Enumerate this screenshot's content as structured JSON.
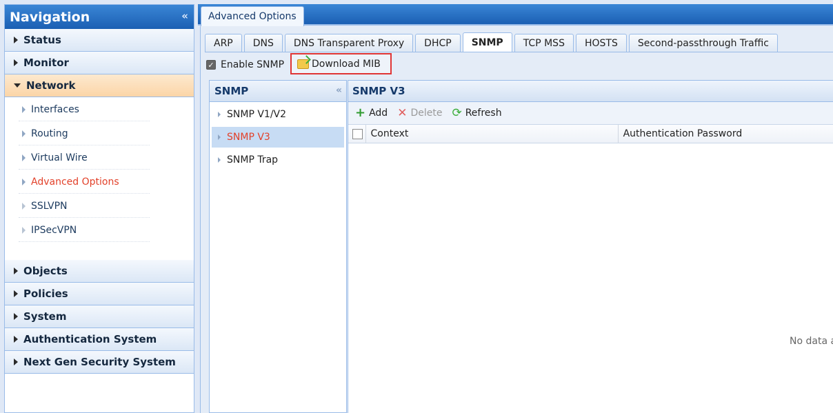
{
  "nav": {
    "title": "Navigation",
    "collapse_icon": "«",
    "sections_top": [
      {
        "label": "Status"
      },
      {
        "label": "Monitor"
      },
      {
        "label": "Network"
      }
    ],
    "network_items": [
      {
        "label": "Interfaces"
      },
      {
        "label": "Routing"
      },
      {
        "label": "Virtual Wire"
      },
      {
        "label": "Advanced Options"
      },
      {
        "label": "SSLVPN"
      },
      {
        "label": "IPSecVPN"
      }
    ],
    "sections_bottom": [
      {
        "label": "Objects"
      },
      {
        "label": "Policies"
      },
      {
        "label": "System"
      },
      {
        "label": "Authentication System"
      },
      {
        "label": "Next Gen Security System"
      }
    ]
  },
  "top_tab": {
    "label": "Advanced Options"
  },
  "tabs": [
    {
      "label": "ARP"
    },
    {
      "label": "DNS"
    },
    {
      "label": "DNS Transparent Proxy"
    },
    {
      "label": "DHCP"
    },
    {
      "label": "SNMP"
    },
    {
      "label": "TCP MSS"
    },
    {
      "label": "HOSTS"
    },
    {
      "label": "Second-passthrough Traffic"
    }
  ],
  "snmp": {
    "enable_label": "Enable SNMP",
    "enable_checked": true,
    "download_label": "Download MIB",
    "tree_title": "SNMP",
    "tree_items": [
      {
        "label": "SNMP V1/V2"
      },
      {
        "label": "SNMP V3"
      },
      {
        "label": "SNMP Trap"
      }
    ]
  },
  "grid": {
    "title": "SNMP V3",
    "add_label": "Add",
    "delete_label": "Delete",
    "refresh_label": "Refresh",
    "columns": [
      "Context",
      "Authentication Password"
    ],
    "empty_text": "No data a"
  },
  "colors": {
    "header_blue": "#1b5fb3",
    "active_red": "#e2412a",
    "highlight_border": "#e03434",
    "open_section": "#fbd5a7"
  }
}
